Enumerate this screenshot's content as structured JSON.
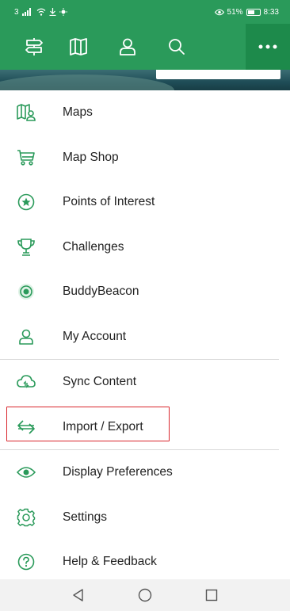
{
  "status_bar": {
    "left_text": "3",
    "battery": "51%",
    "time": "8:33"
  },
  "toolbar": {
    "buttons": [
      {
        "icon": "signpost-icon"
      },
      {
        "icon": "map-book-icon"
      },
      {
        "icon": "person-icon"
      },
      {
        "icon": "search-icon"
      },
      {
        "icon": "more-dots-icon"
      }
    ]
  },
  "menu": {
    "items": [
      {
        "label": "Maps",
        "icon": "maps-icon"
      },
      {
        "label": "Map Shop",
        "icon": "cart-icon"
      },
      {
        "label": "Points of Interest",
        "icon": "star-pin-icon"
      },
      {
        "label": "Challenges",
        "icon": "trophy-icon"
      },
      {
        "label": "BuddyBeacon",
        "icon": "beacon-icon"
      },
      {
        "label": "My Account",
        "icon": "account-icon"
      },
      {
        "label": "Sync Content",
        "icon": "cloud-sync-icon"
      },
      {
        "label": "Import / Export",
        "icon": "import-export-icon"
      },
      {
        "label": "Display Preferences",
        "icon": "eye-icon"
      },
      {
        "label": "Settings",
        "icon": "gear-icon"
      },
      {
        "label": "Help & Feedback",
        "icon": "help-icon"
      }
    ]
  },
  "colors": {
    "brand_green": "#2a9a5a",
    "highlight_red": "#d9262c"
  }
}
